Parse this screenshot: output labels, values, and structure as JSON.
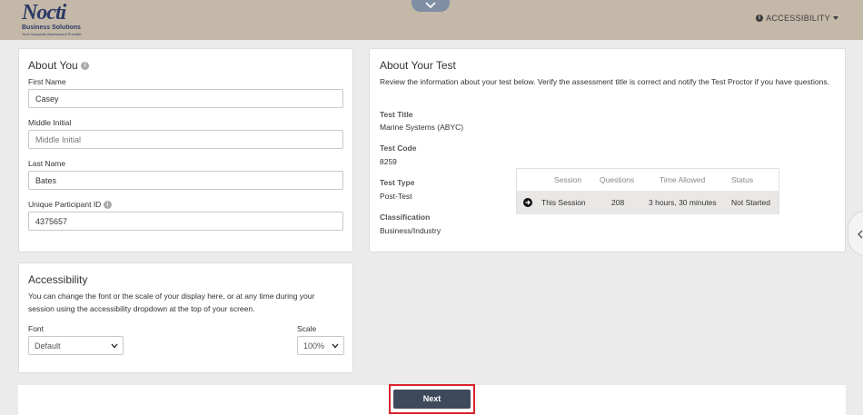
{
  "header": {
    "logo_main": "Nocti",
    "logo_sub": "Business Solutions",
    "logo_tagline": "Your Corporate Assessment Provider",
    "accessibility_menu": "ACCESSIBILITY",
    "bg_color": "#c4b8a8"
  },
  "about_you": {
    "title": "About You",
    "first_name_label": "First Name",
    "first_name_value": "Casey",
    "middle_initial_label": "Middle Initial",
    "middle_initial_placeholder": "Middle Initial",
    "last_name_label": "Last Name",
    "last_name_value": "Bates",
    "participant_id_label": "Unique Participant ID",
    "participant_id_value": "4375657"
  },
  "about_test": {
    "title": "About Your Test",
    "description": "Review the information about your test below. Verify the assessment title is correct and notify the Test Proctor if you have questions.",
    "test_title_label": "Test Title",
    "test_title_value": "Marine Systems (ABYC)",
    "test_code_label": "Test Code",
    "test_code_value": "8259",
    "test_type_label": "Test Type",
    "test_type_value": "Post-Test",
    "classification_label": "Classification",
    "classification_value": "Business/Industry",
    "table": {
      "headers": [
        "Session",
        "Questions",
        "Time Allowed",
        "Status"
      ],
      "row": {
        "session": "This Session",
        "questions": "208",
        "time": "3 hours, 30 minutes",
        "status": "Not Started"
      }
    }
  },
  "accessibility": {
    "title": "Accessibility",
    "description": "You can change the font or the scale of your display here, or at any time during your session using the accessibility dropdown at the top of your screen.",
    "font_label": "Font",
    "font_value": "Default",
    "scale_label": "Scale",
    "scale_value": "100%"
  },
  "footer": {
    "next_label": "Next",
    "highlight_color": "#d9232d"
  }
}
